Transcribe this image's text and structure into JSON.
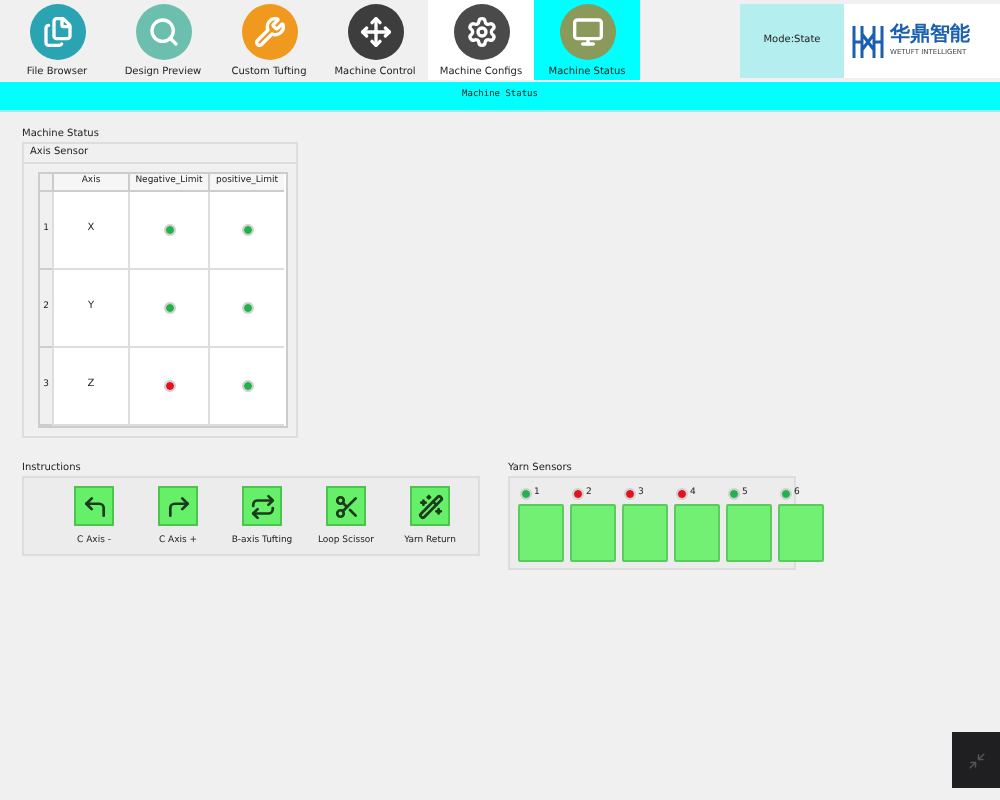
{
  "toolbar": {
    "tabs": [
      {
        "label": "File Browser",
        "selected": false,
        "hovered": false
      },
      {
        "label": "Design Preview",
        "selected": false,
        "hovered": false
      },
      {
        "label": "Custom Tufting",
        "selected": false,
        "hovered": false
      },
      {
        "label": "Machine Control",
        "selected": false,
        "hovered": false
      },
      {
        "label": "Machine Configs",
        "selected": false,
        "hovered": true
      },
      {
        "label": "Machine Status",
        "selected": true,
        "hovered": false
      }
    ],
    "mode": "Mode:State",
    "logo": {
      "name": "华鼎智能",
      "tagline": "WETUFT INTELLIGENT"
    }
  },
  "title_bar": "Machine Status",
  "machine_status": {
    "title": "Machine Status",
    "axis_sensor": {
      "title": "Axis Sensor",
      "columns": [
        "Axis",
        "Negative_Limit",
        "positive_Limit"
      ],
      "rows": [
        {
          "index": "1",
          "axis": "X",
          "negative_limit": {
            "color": "#22b24c"
          },
          "positive_limit": {
            "color": "#22b24c"
          }
        },
        {
          "index": "2",
          "axis": "Y",
          "negative_limit": {
            "color": "#22b24c"
          },
          "positive_limit": {
            "color": "#22b24c"
          }
        },
        {
          "index": "3",
          "axis": "Z",
          "negative_limit": {
            "color": "#e0141e"
          },
          "positive_limit": {
            "color": "#22b24c"
          }
        }
      ]
    }
  },
  "instructions": {
    "title": "Instructions",
    "buttons": [
      {
        "label": "C Axis -"
      },
      {
        "label": "C Axis +"
      },
      {
        "label": "B-axis Tufting"
      },
      {
        "label": "Loop Scissor"
      },
      {
        "label": "Yarn Return"
      }
    ]
  },
  "yarn_sensors": {
    "title": "Yarn Sensors",
    "sensors": [
      {
        "label": "1",
        "color": "#22b24c"
      },
      {
        "label": "2",
        "color": "#e0141e"
      },
      {
        "label": "3",
        "color": "#e0141e"
      },
      {
        "label": "4",
        "color": "#e0141e"
      },
      {
        "label": "5",
        "color": "#22b24c"
      },
      {
        "label": "6",
        "color": "#22b24c"
      }
    ]
  }
}
